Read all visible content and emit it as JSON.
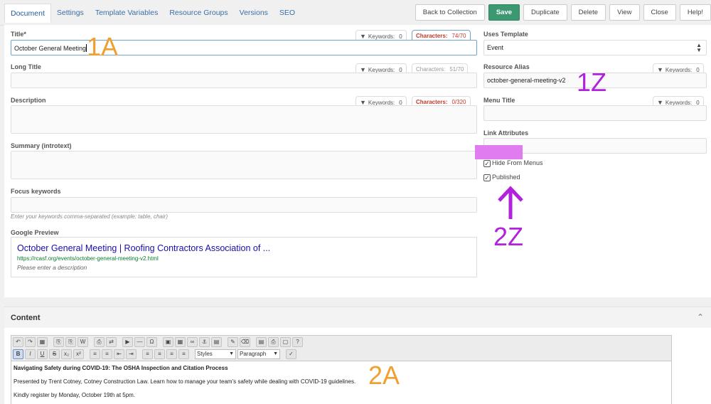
{
  "tabs": [
    "Document",
    "Settings",
    "Template Variables",
    "Resource Groups",
    "Versions",
    "SEO"
  ],
  "actions": {
    "back": "Back to Collection",
    "save": "Save",
    "duplicate": "Duplicate",
    "delete": "Delete",
    "view": "View",
    "close": "Close",
    "help": "Help!"
  },
  "form": {
    "title": {
      "label": "Title*",
      "value": "October General Meeting",
      "keywords_label": "Keywords:",
      "keywords": "0",
      "chars_label": "Characters:",
      "chars": "74/70"
    },
    "long_title": {
      "label": "Long Title",
      "keywords_label": "Keywords:",
      "keywords": "0",
      "chars_label": "Characters:",
      "chars": "51/70"
    },
    "description": {
      "label": "Description",
      "keywords_label": "Keywords:",
      "keywords": "0",
      "chars_label": "Characters:",
      "chars": "0/320"
    },
    "summary": {
      "label": "Summary (introtext)"
    },
    "focus": {
      "label": "Focus keywords",
      "hint": "Enter your keywords comma-separated (example: table, chair)"
    },
    "preview": {
      "label": "Google Preview",
      "title": "October General Meeting | Roofing Contractors Association of ...",
      "url": "https://rcasf.org/events/october-general-meeting-v2.html",
      "desc": "Please enter a description"
    }
  },
  "side": {
    "template_label": "Uses Template",
    "template_value": "Event",
    "alias_label": "Resource Alias",
    "alias_value": "october-general-meeting-v2",
    "alias_keywords_label": "Keywords:",
    "alias_keywords": "0",
    "menu_label": "Menu Title",
    "menu_keywords_label": "Keywords:",
    "menu_keywords": "0",
    "link_label": "Link Attributes",
    "hide_menus": "Hide From Menus",
    "published": "Published"
  },
  "annotations": {
    "a1": "1A",
    "z1": "1Z",
    "z2": "2Z",
    "a2": "2A"
  },
  "content": {
    "title": "Content",
    "styles_select": "Styles",
    "format_select": "Paragraph",
    "lines": [
      "Navigating Safety during COVID-19: The OSHA Inspection and Citation Process",
      "Presented by Trent Cotney, Cotney Construction Law. Learn how to manage your team's safety while dealing with COVID-19 guidelines.",
      "Kindly register by Monday, October 19th at 5pm."
    ]
  },
  "colors": {
    "accent": "#3c9870",
    "annotation_orange": "#f0a030",
    "annotation_purple": "#b222dd",
    "highlight": "#e07cf0"
  }
}
